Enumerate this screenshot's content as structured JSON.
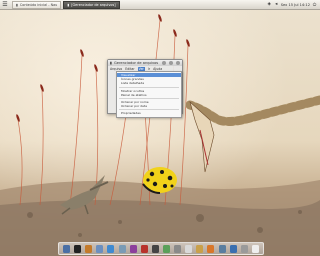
{
  "panel": {
    "menu_icon": "menu-icon",
    "tasks": [
      {
        "label": "Conteúdo inicial - Nau",
        "icon": "folder-icon",
        "active": false
      },
      {
        "label": "[Gerenciador de arquivos]",
        "icon": "folder-icon",
        "active": true
      }
    ],
    "clock": "Sex 15 Jul 14:12",
    "tray_icons": [
      "network-icon",
      "volume-icon",
      "power-icon"
    ]
  },
  "window": {
    "title": "Gerenciador de arquivos",
    "menus": [
      "Arquivo",
      "Editar",
      "Ver",
      "Ir",
      "Ajuda"
    ],
    "selected_menu": "Ver",
    "dropdown": [
      {
        "label": "Visualizar",
        "highlighted": true
      },
      {
        "label": "Ícones grandes",
        "highlighted": false
      },
      {
        "label": "Lista detalhada",
        "highlighted": false
      },
      {
        "sep": true
      },
      {
        "label": "Mostrar ocultos",
        "highlighted": false
      },
      {
        "label": "Painel de atalhos",
        "highlighted": false
      },
      {
        "sep": true
      },
      {
        "label": "Ordenar por nome",
        "highlighted": false
      },
      {
        "label": "Ordenar por data",
        "highlighted": false
      },
      {
        "sep": true
      },
      {
        "label": "Propriedades",
        "highlighted": false
      }
    ]
  },
  "dock": {
    "icons": [
      {
        "name": "finder-icon",
        "color": "#4a6fa5"
      },
      {
        "name": "terminal-icon",
        "color": "#222222"
      },
      {
        "name": "photos-icon",
        "color": "#c47a2a"
      },
      {
        "name": "mail-icon",
        "color": "#6c8fbf"
      },
      {
        "name": "browser-icon",
        "color": "#3f8ad1"
      },
      {
        "name": "search-icon",
        "color": "#7a9bb5"
      },
      {
        "name": "music-icon",
        "color": "#8c3f9c"
      },
      {
        "name": "calendar-icon",
        "color": "#b8332c"
      },
      {
        "name": "video-icon",
        "color": "#444444"
      },
      {
        "name": "chat-icon",
        "color": "#5aa05a"
      },
      {
        "name": "settings-icon",
        "color": "#8a8a8a"
      },
      {
        "name": "document-icon",
        "color": "#d9d9d9"
      },
      {
        "name": "folder-icon",
        "color": "#c9a04a"
      },
      {
        "name": "firefox-icon",
        "color": "#d9772a"
      },
      {
        "name": "image-icon",
        "color": "#5a7ea0"
      },
      {
        "name": "network-icon",
        "color": "#3a6fb0"
      },
      {
        "name": "trash-icon",
        "color": "#9a9a9a"
      },
      {
        "name": "clock-icon",
        "color": "#eeeeee"
      }
    ]
  }
}
